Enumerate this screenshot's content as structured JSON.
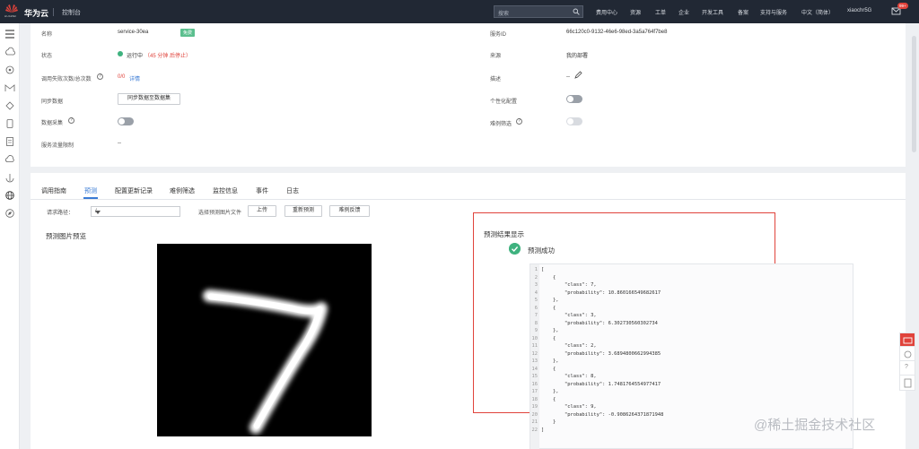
{
  "topbar": {
    "brand": "华为云",
    "logo_text": "HUAWEI",
    "console": "控制台",
    "search_placeholder": "搜索",
    "nav": [
      "费用中心",
      "资源",
      "工单",
      "企业",
      "开发工具",
      "备案",
      "支持与服务",
      "中文（简体）",
      "xiaochr5G"
    ],
    "badge": "99+"
  },
  "info": {
    "name_label": "名称",
    "name_value": "service-30ea",
    "free_tag": "免费",
    "status_label": "状态",
    "status_value": "运行中",
    "status_time": "（45 分钟 后停止）",
    "calls_label": "调用失败次数/总次数",
    "calls_value": "0/0",
    "calls_link": "详情",
    "sync_label": "同步数据",
    "sync_button": "同步数据至数据集",
    "collect_label": "数据采集",
    "batch_label": "服务流量限制",
    "batch_value": "--",
    "id_label": "服务ID",
    "id_value": "66c120c0-9132-46e6-98ed-3a5a764f7be8",
    "source_label": "来源",
    "source_value": "我的部署",
    "desc_label": "描述",
    "desc_value": "--",
    "personal_label": "个性化配置",
    "filter_label": "难例筛选"
  },
  "tabs": [
    "调用指南",
    "预测",
    "配置更新记录",
    "难例筛选",
    "监控信息",
    "事件",
    "日志"
  ],
  "predict": {
    "path_label": "请求路径：",
    "path_value": "/",
    "file_label": "选择预测图片文件",
    "upload": "上传",
    "repredict": "重新预测",
    "hard_sync": "难例反馈",
    "preview_title": "预测图片预览",
    "result_title": "预测结果显示",
    "success_text": "预测成功"
  },
  "code_lines": [
    "[",
    "    {",
    "        \"class\": 7,",
    "        \"probability\": 10.860166549682617",
    "    },",
    "    {",
    "        \"class\": 3,",
    "        \"probability\": 6.302730560302734",
    "    },",
    "    {",
    "        \"class\": 2,",
    "        \"probability\": 3.6894800662994385",
    "    },",
    "    {",
    "        \"class\": 8,",
    "        \"probability\": 1.7481764554977417",
    "    },",
    "    {",
    "        \"class\": 9,",
    "        \"probability\": -0.9086264371871948",
    "    }",
    "]"
  ],
  "watermark": "@稀土掘金技术社区",
  "colors": {
    "accent": "#3a7bd5",
    "success": "#3fb27f",
    "danger": "#e0433b"
  }
}
